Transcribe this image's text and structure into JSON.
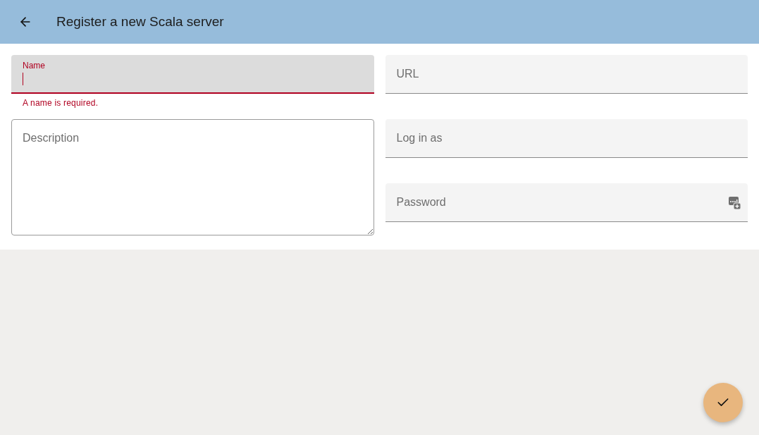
{
  "app_bar": {
    "title": "Register a new Scala server"
  },
  "form": {
    "columns": [
      {
        "fields": [
          {
            "kind": "text",
            "label": "Name",
            "focused": true,
            "invalid": true,
            "error": "A name is required."
          },
          {
            "kind": "textarea",
            "placeholder": "Description",
            "focused": false,
            "invalid": false
          }
        ]
      },
      {
        "fields": [
          {
            "kind": "text",
            "placeholder": "URL",
            "focused": false,
            "invalid": false
          },
          {
            "kind": "text",
            "placeholder": "Log in as",
            "focused": false,
            "invalid": false
          },
          {
            "kind": "password",
            "placeholder": "Password",
            "focused": false,
            "invalid": false
          }
        ]
      }
    ]
  }
}
